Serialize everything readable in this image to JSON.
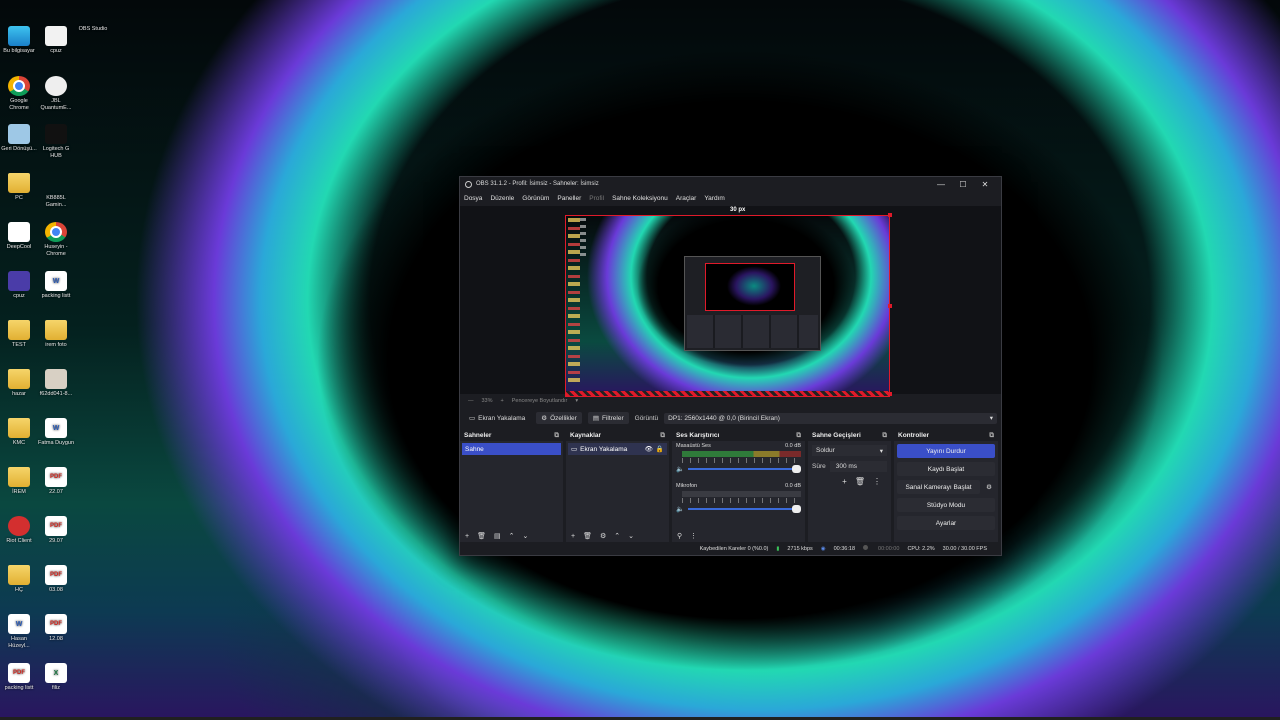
{
  "desktop_icons": [
    {
      "label": "Bu bilgisayar",
      "icon": "monitor-icon"
    },
    {
      "label": "cpuz",
      "icon": "file-icon"
    },
    {
      "label": "OBS Studio",
      "icon": "obs-icon"
    },
    {
      "label": "Google Chrome",
      "icon": "chrome-icon"
    },
    {
      "label": "JBL QuantumE...",
      "icon": "jbl-icon"
    },
    {
      "label": "Geri Dönüşü...",
      "icon": "recycle-bin-icon"
    },
    {
      "label": "Logitech G HUB",
      "icon": "logitech-icon"
    },
    {
      "label": "PC",
      "icon": "folder-icon"
    },
    {
      "label": "KB885L Gamin...",
      "icon": "hyperx-icon"
    },
    {
      "label": "DeepCool",
      "icon": "deepcool-icon"
    },
    {
      "label": "Huseyin - Chrome",
      "icon": "chrome-icon"
    },
    {
      "label": "cpuz",
      "icon": "cpuz-icon"
    },
    {
      "label": "packing listt",
      "icon": "word-icon"
    },
    {
      "label": "TEST",
      "icon": "folder-icon"
    },
    {
      "label": "irem foto",
      "icon": "folder-icon"
    },
    {
      "label": "hazar",
      "icon": "folder-icon"
    },
    {
      "label": "f62dd041-8...",
      "icon": "photo-icon"
    },
    {
      "label": "KMC",
      "icon": "folder-icon"
    },
    {
      "label": "Fatma Duygun",
      "icon": "word-icon"
    },
    {
      "label": "İREM",
      "icon": "folder-icon"
    },
    {
      "label": "22.07",
      "icon": "pdf-icon"
    },
    {
      "label": "Riot Client",
      "icon": "riot-icon"
    },
    {
      "label": "29.07",
      "icon": "pdf-icon"
    },
    {
      "label": "HÇ",
      "icon": "folder-icon"
    },
    {
      "label": "03.08",
      "icon": "pdf-icon"
    },
    {
      "label": "Hasan Hüzeyl...",
      "icon": "word-icon"
    },
    {
      "label": "12.08",
      "icon": "pdf-icon"
    },
    {
      "label": "packing listt",
      "icon": "pdf-icon"
    },
    {
      "label": "filiz",
      "icon": "excel-icon"
    }
  ],
  "icon_glyphs": {
    "pdf": "PDF",
    "word": "W",
    "excel": "X"
  },
  "window": {
    "title": "OBS 31.1.2 - Profil: İsimsiz - Sahneler: İsimsiz",
    "minimize": "—",
    "maximize": "☐",
    "close": "✕"
  },
  "menu": [
    "Dosya",
    "Düzenle",
    "Görünüm",
    "Paneller",
    "Profil",
    "Sahne Koleksiyonu",
    "Araçlar",
    "Yardım"
  ],
  "preview": {
    "edge_label": "30 px",
    "zoom": "33%",
    "zoom_plus": "+",
    "resize_label": "Pencereye Boyutlandır",
    "resize_arrow": "▾"
  },
  "source_bar": {
    "source_name": "Ekran Yakalama",
    "properties": "Özellikler",
    "filters": "Filtreler",
    "display_label": "Görüntü",
    "display_value": "DP1: 2560x1440 @ 0,0 (Birincil Ekran)"
  },
  "docks": {
    "scenes": {
      "title": "Sahneler",
      "items": [
        "Sahne"
      ]
    },
    "sources": {
      "title": "Kaynaklar",
      "items": [
        "Ekran Yakalama"
      ]
    },
    "mixer": {
      "title": "Ses Karıştırıcı",
      "channels": [
        {
          "name": "Masaüstü Ses",
          "db": "0.0 dB",
          "level": 1.0
        },
        {
          "name": "Mikrofon",
          "db": "0.0 dB",
          "level": 1.0
        }
      ]
    },
    "transitions": {
      "title": "Sahne Geçişleri",
      "selected": "Soldur",
      "duration_label": "Süre",
      "duration_value": "300 ms"
    },
    "controls": {
      "title": "Kontroller",
      "stop_stream": "Yayını Durdur",
      "start_recording": "Kaydı Başlat",
      "virtual_cam": "Sanal Kamerayı Başlat",
      "studio_mode": "Stüdyo Modu",
      "settings": "Ayarlar"
    }
  },
  "status": {
    "dropped_frames": "Kaybedilen Kareler 0 (%0.0)",
    "bitrate": "2715 kbps",
    "stream_time": "00:36:18",
    "record_time": "00:00:00",
    "cpu": "CPU: 2.2%",
    "fps": "30.00 / 30.00 FPS"
  },
  "colors": {
    "accent": "#3a4fc8",
    "selection_border": "#e01a2a"
  }
}
